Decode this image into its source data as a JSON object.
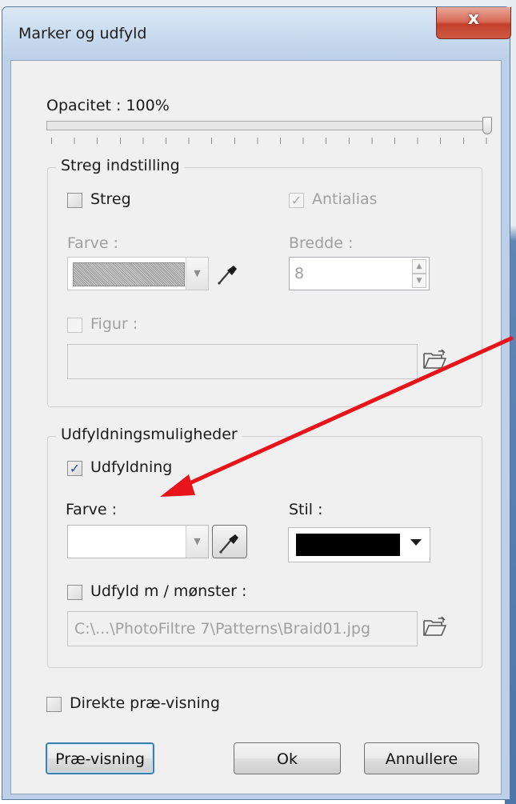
{
  "window": {
    "title": "Marker og udfyld",
    "close_glyph": "x"
  },
  "opacity": {
    "label": "Opacitet : 100%",
    "value_percent": 100
  },
  "stroke_group": {
    "legend": "Streg indstilling",
    "stroke_checkbox": {
      "label": "Streg",
      "checked": false
    },
    "antialias_checkbox": {
      "label": "Antialias",
      "checked": true,
      "enabled": false
    },
    "color_label": "Farve :",
    "width_label": "Bredde :",
    "width_value": "8",
    "figure_checkbox": {
      "label": "Figur :",
      "checked": false,
      "enabled": false
    },
    "figure_path": ""
  },
  "fill_group": {
    "legend": "Udfyldningsmuligheder",
    "fill_checkbox": {
      "label": "Udfyldning",
      "checked": true
    },
    "color_label": "Farve :",
    "style_label": "Stil :",
    "style_color": "#000000",
    "pattern_checkbox": {
      "label": "Udfyld m / mønster :",
      "checked": false
    },
    "pattern_path": "C:\\...\\PhotoFiltre 7\\Patterns\\Braid01.jpg"
  },
  "direct_preview": {
    "label": "Direkte præ-visning",
    "checked": false
  },
  "buttons": {
    "preview": "Præ-visning",
    "ok": "Ok",
    "cancel": "Annullere"
  },
  "icons": {
    "close": "close-icon",
    "pipette": "eyedropper-icon",
    "folder": "open-folder-icon",
    "annotation": "red-arrow"
  },
  "colors": {
    "accent_checkmark": "#2a4a9a",
    "annotation_arrow": "#e8141b",
    "close_button": "#c3402a"
  }
}
